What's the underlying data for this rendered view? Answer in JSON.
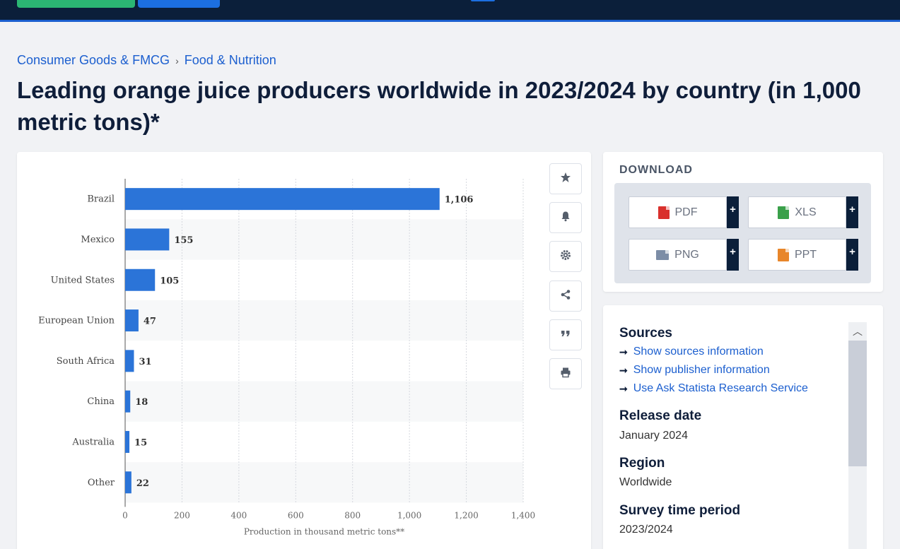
{
  "breadcrumb": {
    "item1": "Consumer Goods & FMCG",
    "separator": "›",
    "item2": "Food & Nutrition"
  },
  "title": "Leading orange juice producers worldwide in 2023/2024 by country (in 1,000 metric tons)*",
  "tools": {
    "favorite": "star-icon",
    "alert": "bell-icon",
    "settings": "gear-icon",
    "share": "share-icon",
    "cite": "quote-icon",
    "print": "print-icon"
  },
  "download": {
    "title": "DOWNLOAD",
    "pdf": "PDF",
    "xls": "XLS",
    "png": "PNG",
    "ppt": "PPT",
    "plus": "+"
  },
  "info": {
    "sources_heading": "Sources",
    "link_sources": "Show sources information",
    "link_publisher": "Show publisher information",
    "link_research": "Use Ask Statista Research Service",
    "release_heading": "Release date",
    "release_value": "January 2024",
    "region_heading": "Region",
    "region_value": "Worldwide",
    "period_heading": "Survey time period",
    "period_value": "2023/2024"
  },
  "colors": {
    "bar": "#2b74d8",
    "accent": "#1c5fcf",
    "nav": "#0b1f3a"
  },
  "chart_data": {
    "type": "bar",
    "orientation": "horizontal",
    "categories": [
      "Brazil",
      "Mexico",
      "United States",
      "European Union",
      "South Africa",
      "China",
      "Australia",
      "Other"
    ],
    "values": [
      1106,
      155,
      105,
      47,
      31,
      18,
      15,
      22
    ],
    "value_labels": [
      "1,106",
      "155",
      "105",
      "47",
      "31",
      "18",
      "15",
      "22"
    ],
    "xlabel": "Production in thousand metric tons**",
    "xlim": [
      0,
      1400
    ],
    "xticks": [
      0,
      200,
      400,
      600,
      800,
      1000,
      1200,
      1400
    ],
    "xtick_labels": [
      "0",
      "200",
      "400",
      "600",
      "800",
      "1,000",
      "1,200",
      "1,400"
    ],
    "grid": true
  }
}
